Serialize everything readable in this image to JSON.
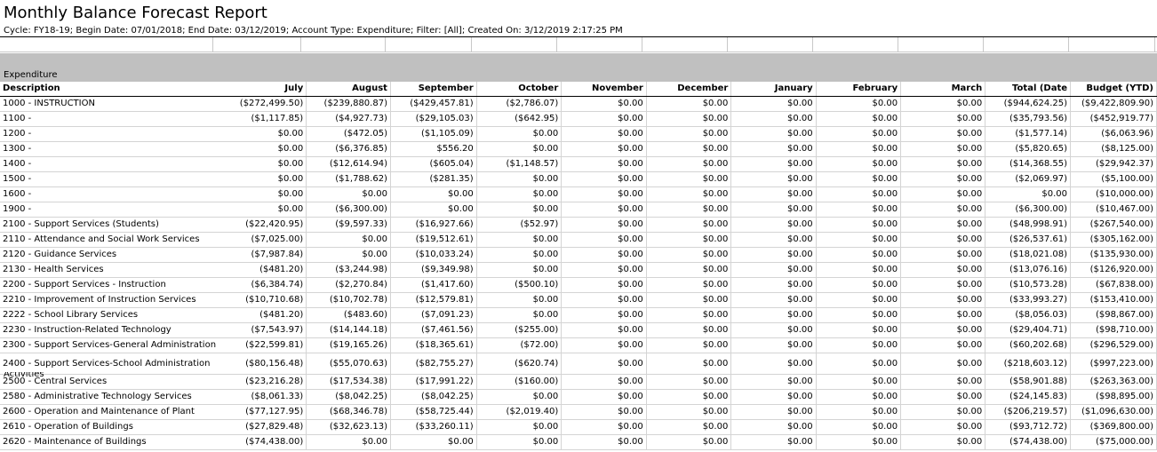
{
  "report": {
    "title": "Monthly Balance Forecast Report",
    "subtitle": "Cycle: FY18-19; Begin Date: 07/01/2018; End Date: 03/12/2019; Account Type: Expenditure; Filter: [All]; Created On: 3/12/2019 2:17:25 PM"
  },
  "section_label": "Expenditure",
  "columns": [
    "Description",
    "July",
    "August",
    "September",
    "October",
    "November",
    "December",
    "January",
    "February",
    "March",
    "Total (Date",
    "Budget (YTD)"
  ],
  "rows": [
    [
      "1000 - INSTRUCTION",
      "($272,499.50)",
      "($239,880.87)",
      "($429,457.81)",
      "($2,786.07)",
      "$0.00",
      "$0.00",
      "$0.00",
      "$0.00",
      "$0.00",
      "($944,624.25)",
      "($9,422,809.90)"
    ],
    [
      "1100 -",
      "($1,117.85)",
      "($4,927.73)",
      "($29,105.03)",
      "($642.95)",
      "$0.00",
      "$0.00",
      "$0.00",
      "$0.00",
      "$0.00",
      "($35,793.56)",
      "($452,919.77)"
    ],
    [
      "1200 -",
      "$0.00",
      "($472.05)",
      "($1,105.09)",
      "$0.00",
      "$0.00",
      "$0.00",
      "$0.00",
      "$0.00",
      "$0.00",
      "($1,577.14)",
      "($6,063.96)"
    ],
    [
      "1300 -",
      "$0.00",
      "($6,376.85)",
      "$556.20",
      "$0.00",
      "$0.00",
      "$0.00",
      "$0.00",
      "$0.00",
      "$0.00",
      "($5,820.65)",
      "($8,125.00)"
    ],
    [
      "1400 -",
      "$0.00",
      "($12,614.94)",
      "($605.04)",
      "($1,148.57)",
      "$0.00",
      "$0.00",
      "$0.00",
      "$0.00",
      "$0.00",
      "($14,368.55)",
      "($29,942.37)"
    ],
    [
      "1500 -",
      "$0.00",
      "($1,788.62)",
      "($281.35)",
      "$0.00",
      "$0.00",
      "$0.00",
      "$0.00",
      "$0.00",
      "$0.00",
      "($2,069.97)",
      "($5,100.00)"
    ],
    [
      "1600 -",
      "$0.00",
      "$0.00",
      "$0.00",
      "$0.00",
      "$0.00",
      "$0.00",
      "$0.00",
      "$0.00",
      "$0.00",
      "$0.00",
      "($10,000.00)"
    ],
    [
      "1900 -",
      "$0.00",
      "($6,300.00)",
      "$0.00",
      "$0.00",
      "$0.00",
      "$0.00",
      "$0.00",
      "$0.00",
      "$0.00",
      "($6,300.00)",
      "($10,467.00)"
    ],
    [
      "2100 - Support Services (Students)",
      "($22,420.95)",
      "($9,597.33)",
      "($16,927.66)",
      "($52.97)",
      "$0.00",
      "$0.00",
      "$0.00",
      "$0.00",
      "$0.00",
      "($48,998.91)",
      "($267,540.00)"
    ],
    [
      "2110 - Attendance and Social Work Services",
      "($7,025.00)",
      "$0.00",
      "($19,512.61)",
      "$0.00",
      "$0.00",
      "$0.00",
      "$0.00",
      "$0.00",
      "$0.00",
      "($26,537.61)",
      "($305,162.00)"
    ],
    [
      "2120 - Guidance Services",
      "($7,987.84)",
      "$0.00",
      "($10,033.24)",
      "$0.00",
      "$0.00",
      "$0.00",
      "$0.00",
      "$0.00",
      "$0.00",
      "($18,021.08)",
      "($135,930.00)"
    ],
    [
      "2130 - Health Services",
      "($481.20)",
      "($3,244.98)",
      "($9,349.98)",
      "$0.00",
      "$0.00",
      "$0.00",
      "$0.00",
      "$0.00",
      "$0.00",
      "($13,076.16)",
      "($126,920.00)"
    ],
    [
      "2200 - Support Services - Instruction",
      "($6,384.74)",
      "($2,270.84)",
      "($1,417.60)",
      "($500.10)",
      "$0.00",
      "$0.00",
      "$0.00",
      "$0.00",
      "$0.00",
      "($10,573.28)",
      "($67,838.00)"
    ],
    [
      "2210 - Improvement of Instruction Services",
      "($10,710.68)",
      "($10,702.78)",
      "($12,579.81)",
      "$0.00",
      "$0.00",
      "$0.00",
      "$0.00",
      "$0.00",
      "$0.00",
      "($33,993.27)",
      "($153,410.00)"
    ],
    [
      "2222 - School Library Services",
      "($481.20)",
      "($483.60)",
      "($7,091.23)",
      "$0.00",
      "$0.00",
      "$0.00",
      "$0.00",
      "$0.00",
      "$0.00",
      "($8,056.03)",
      "($98,867.00)"
    ],
    [
      "2230 - Instruction-Related Technology",
      "($7,543.97)",
      "($14,144.18)",
      "($7,461.56)",
      "($255.00)",
      "$0.00",
      "$0.00",
      "$0.00",
      "$0.00",
      "$0.00",
      "($29,404.71)",
      "($98,710.00)"
    ],
    [
      "2300 - Support Services-General Administration",
      "($22,599.81)",
      "($19,165.26)",
      "($18,365.61)",
      "($72.00)",
      "$0.00",
      "$0.00",
      "$0.00",
      "$0.00",
      "$0.00",
      "($60,202.68)",
      "($296,529.00)"
    ],
    [
      "2400 - Support Services-School Administration",
      "($80,156.48)",
      "($55,070.63)",
      "($82,755.27)",
      "($620.74)",
      "$0.00",
      "$0.00",
      "$0.00",
      "$0.00",
      "$0.00",
      "($218,603.12)",
      "($997,223.00)"
    ],
    [
      "2500 - Central Services",
      "($23,216.28)",
      "($17,534.38)",
      "($17,991.22)",
      "($160.00)",
      "$0.00",
      "$0.00",
      "$0.00",
      "$0.00",
      "$0.00",
      "($58,901.88)",
      "($263,363.00)"
    ],
    [
      "2580 - Administrative Technology Services",
      "($8,061.33)",
      "($8,042.25)",
      "($8,042.25)",
      "$0.00",
      "$0.00",
      "$0.00",
      "$0.00",
      "$0.00",
      "$0.00",
      "($24,145.83)",
      "($98,895.00)"
    ],
    [
      "2600 - Operation and Maintenance of Plant",
      "($77,127.95)",
      "($68,346.78)",
      "($58,725.44)",
      "($2,019.40)",
      "$0.00",
      "$0.00",
      "$0.00",
      "$0.00",
      "$0.00",
      "($206,219.57)",
      "($1,096,630.00)"
    ],
    [
      "2610 - Operation of Buildings",
      "($27,829.48)",
      "($32,623.13)",
      "($33,260.11)",
      "$0.00",
      "$0.00",
      "$0.00",
      "$0.00",
      "$0.00",
      "$0.00",
      "($93,712.72)",
      "($369,800.00)"
    ],
    [
      "2620 - Maintenance of Buildings",
      "($74,438.00)",
      "$0.00",
      "$0.00",
      "$0.00",
      "$0.00",
      "$0.00",
      "$0.00",
      "$0.00",
      "$0.00",
      "($74,438.00)",
      "($75,000.00)"
    ]
  ],
  "truncated_text": "Activities"
}
